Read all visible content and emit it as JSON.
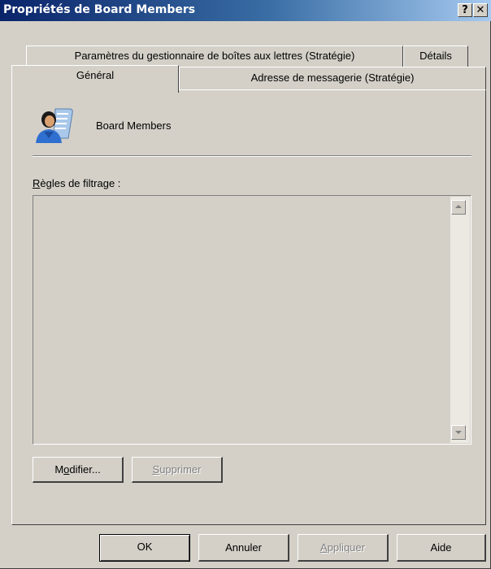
{
  "window": {
    "title": "Propriétés de Board Members",
    "help_glyph": "?",
    "close_glyph": "✕"
  },
  "tabs": {
    "row1": [
      {
        "label": "Paramètres du gestionnaire de boîtes aux lettres (Stratégie)"
      },
      {
        "label": "Détails"
      }
    ],
    "row2": [
      {
        "label": "Général",
        "selected": true
      },
      {
        "label": "Adresse de messagerie (Stratégie)"
      }
    ]
  },
  "general": {
    "icon": "group-user-icon",
    "name": "Board Members",
    "filter_label_accel": "R",
    "filter_label_rest": "ègles de filtrage :",
    "modify_accel_pre": "M",
    "modify_accel": "o",
    "modify_rest": "difier...",
    "delete_accel": "S",
    "delete_rest": "upprimer"
  },
  "footer": {
    "ok": "OK",
    "cancel": "Annuler",
    "apply_accel": "A",
    "apply_rest": "ppliquer",
    "help": "Aide"
  },
  "colors": {
    "face": "#d4d0c8",
    "title_start": "#0a246a",
    "title_end": "#a6caf0"
  }
}
